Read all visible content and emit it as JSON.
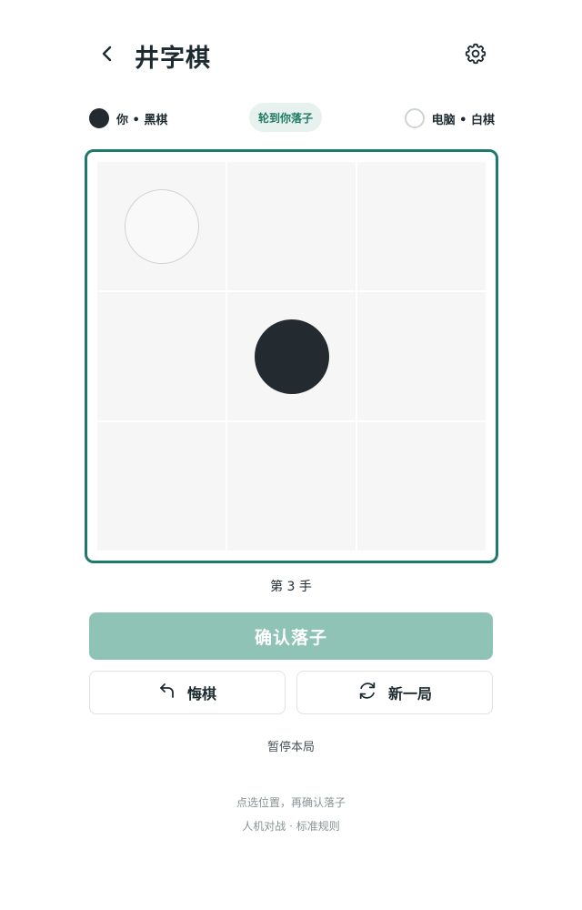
{
  "header": {
    "title": "井字棋",
    "back_icon": "chevron-left-icon",
    "settings_icon": "gear-icon"
  },
  "players": {
    "you": {
      "label": "你 • 黑棋",
      "stone": "black"
    },
    "cpu": {
      "label": "电脑 • 白棋",
      "stone": "white"
    },
    "turn_badge": "轮到你落子"
  },
  "board": {
    "rows": 3,
    "cols": 3,
    "cells": [
      "white",
      "",
      "",
      "",
      "black",
      "",
      "",
      "",
      ""
    ]
  },
  "move_count": "第 3 手",
  "actions": {
    "confirm_label": "确认落子",
    "confirm_enabled": false,
    "undo_label": "悔棋",
    "undo_icon": "undo-arrow-icon",
    "new_game_label": "新一局",
    "new_game_icon": "refresh-icon",
    "pause_label": "暂停本局"
  },
  "footer": {
    "hint": "点选位置，再确认落子",
    "mode": "人机对战 · 标准规则"
  },
  "colors": {
    "accent": "#1e7a6b",
    "confirm_disabled": "#8fc3b5",
    "badge_bg": "#e7f2ef",
    "badge_text": "#1f7a64",
    "cell_bg": "#f5f6f5",
    "black_stone": "#232b30",
    "white_stone": "#f9f9f9"
  }
}
